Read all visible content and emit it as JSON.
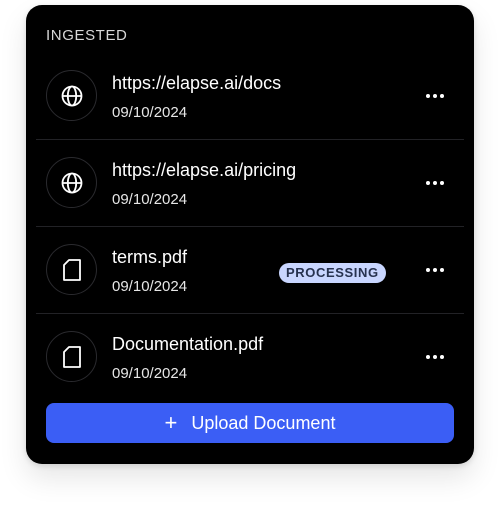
{
  "section_title": "INGESTED",
  "items": [
    {
      "name": "https://elapse.ai/docs",
      "date": "09/10/2024",
      "icon": "globe-icon",
      "status": ""
    },
    {
      "name": "https://elapse.ai/pricing",
      "date": "09/10/2024",
      "icon": "globe-icon",
      "status": ""
    },
    {
      "name": "terms.pdf",
      "date": "09/10/2024",
      "icon": "file-icon",
      "status": "PROCESSING"
    },
    {
      "name": "Documentation.pdf",
      "date": "09/10/2024",
      "icon": "file-icon",
      "status": ""
    }
  ],
  "upload_button": {
    "label": "Upload Document",
    "icon": "plus-icon",
    "plus_glyph": "+"
  },
  "colors": {
    "panel": "#000000",
    "accent": "#3b5ef5",
    "badge_bg": "#c9d6ff",
    "badge_text": "#27324f"
  }
}
